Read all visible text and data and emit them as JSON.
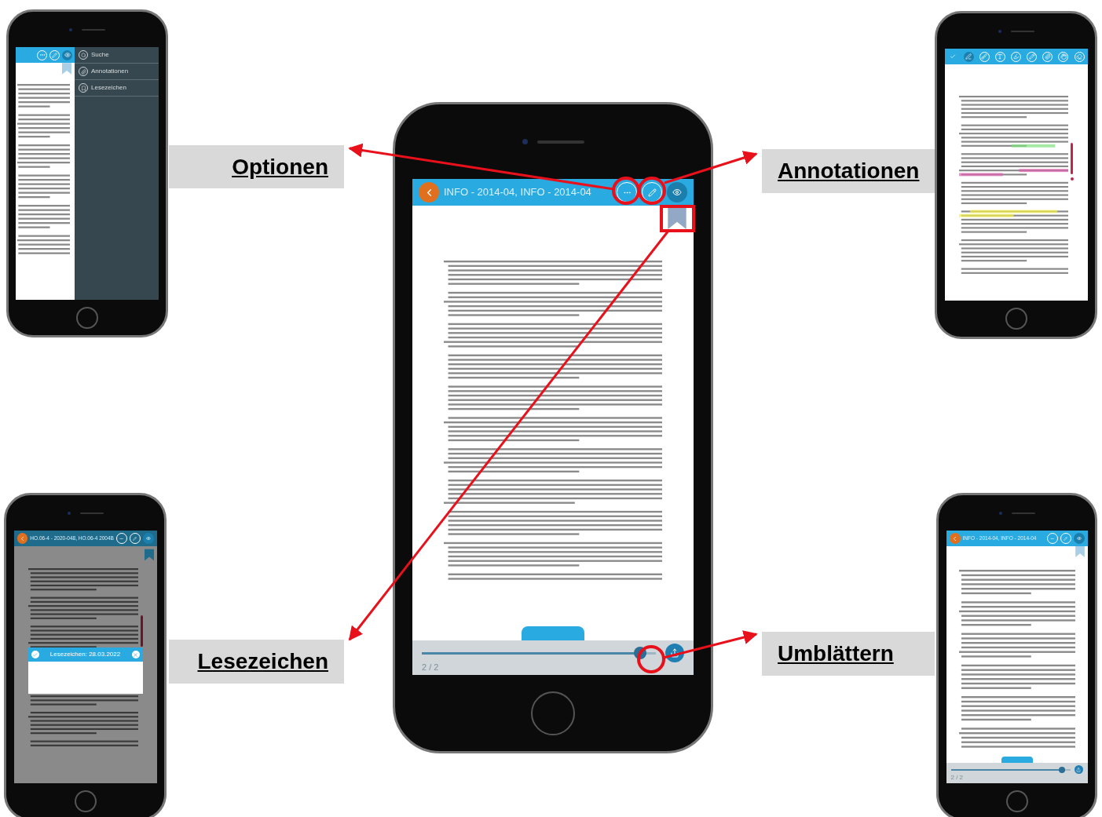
{
  "callouts": [
    {
      "label": "Optionen"
    },
    {
      "label": "Annotationen"
    },
    {
      "label": "Lesezeichen"
    },
    {
      "label": "Umblättern"
    }
  ],
  "options_phone": {
    "menu_items": [
      {
        "label": "Suche"
      },
      {
        "label": "Annotationen"
      },
      {
        "label": "Lesezeichen"
      }
    ]
  },
  "main_phone": {
    "title": "INFO - 2014-04, INFO - 2014-04",
    "page_indicator": "2 / 2",
    "page_slider": {
      "level": 0.96
    }
  },
  "bookmark_phone": {
    "title": "HO.06-4 - 2020-048, HO.06-4 2004B",
    "dialog_title": "Lesezeichen: 28.03.2022"
  },
  "pageturn_phone": {
    "title": "INFO - 2014-04, INFO - 2014-04",
    "page_indicator": "2 / 2",
    "page_slider": {
      "level": 0.96
    }
  }
}
